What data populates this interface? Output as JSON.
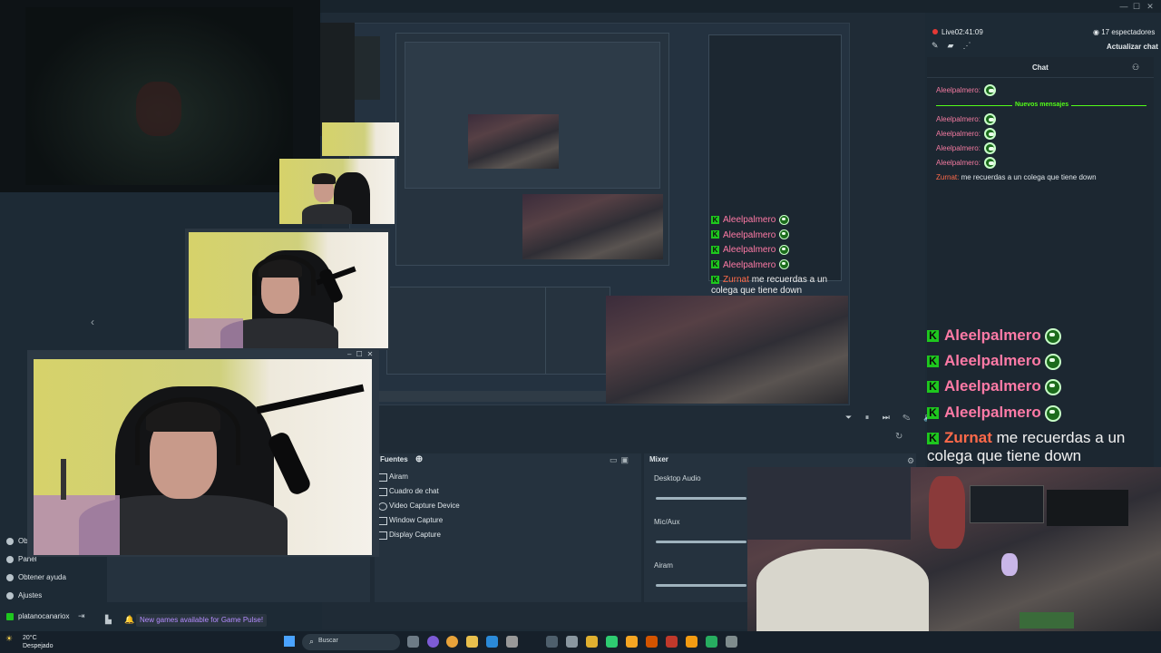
{
  "window": {
    "minimize": "—",
    "maximize": "☐",
    "close": "✕"
  },
  "stream": {
    "live_label": "Live",
    "live_time": "02:41:09",
    "viewers": "17 espectadores",
    "refresh_label": "Actualizar chat"
  },
  "chat": {
    "title": "Chat",
    "new_messages": "Nuevos mensajes",
    "messages": [
      {
        "user": "Aleelpalmero",
        "text": ""
      },
      {
        "user": "Aleelpalmero",
        "text": ""
      },
      {
        "user": "Aleelpalmero",
        "text": ""
      },
      {
        "user": "Aleelpalmero",
        "text": ""
      },
      {
        "user": "Aleelpalmero",
        "text": ""
      },
      {
        "user": "Zurnat",
        "text": "me recuerdas a un colega que tiene down"
      }
    ]
  },
  "overlay_chat": {
    "lines": [
      {
        "user": "Aleelpalmero"
      },
      {
        "user": "Aleelpalmero"
      },
      {
        "user": "Aleelpalmero"
      },
      {
        "user": "Aleelpalmero"
      }
    ],
    "last_user": "Zurnat",
    "last_text_1": "me recuerdas a un",
    "last_text_2": "colega que tiene down"
  },
  "preview_overlay_chat": {
    "lines": [
      "Aleelpalmero",
      "Aleelpalmero",
      "Aleelpalmero",
      "Aleelpalmero"
    ],
    "last_user": "Zurnat",
    "last_text_1": "me recuerdas a un",
    "last_text_2": "colega que tiene down"
  },
  "sources": {
    "title": "Fuentes",
    "items": [
      "Airam",
      "Cuadro de chat",
      "Video Capture Device",
      "Window Capture",
      "Display Capture"
    ]
  },
  "mixer": {
    "title": "Mixer",
    "channels": [
      "Desktop Audio",
      "Mic/Aux",
      "Airam"
    ]
  },
  "left_panel": {
    "items": [
      "Obt",
      "Panel",
      "Obtener ayuda",
      "Ajustes"
    ],
    "user": "platanocanariox",
    "notification": "New games available for Game Pulse!"
  },
  "taskbar": {
    "weather_temp": "20°C",
    "weather_desc": "Despejado",
    "search_placeholder": "Buscar"
  },
  "colors": {
    "username": "#ff7aa6",
    "kick_green": "#1ec71e",
    "new_msgs": "#53fc18",
    "zurnat": "#ff6a4a"
  }
}
